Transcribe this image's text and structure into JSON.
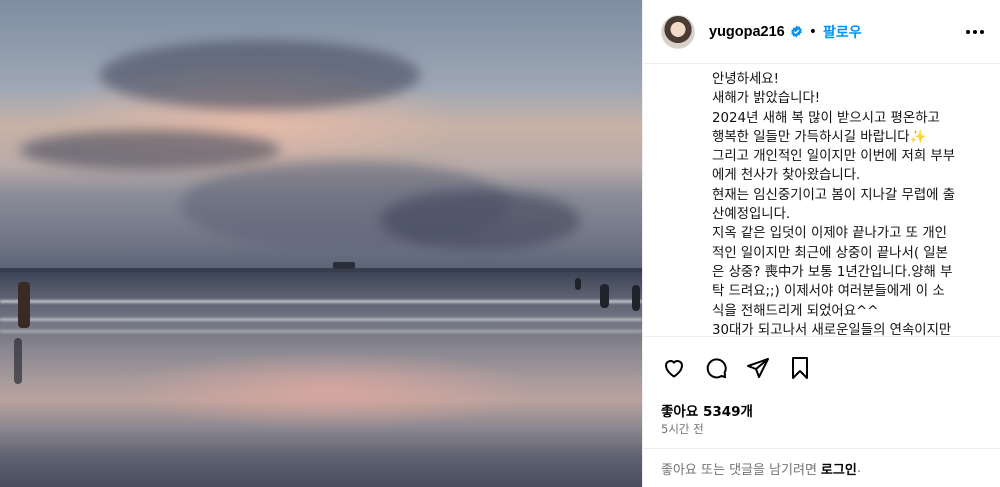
{
  "post": {
    "username": "yugopa216",
    "follow_label": "팔로우",
    "separator": "•",
    "caption_lines": [
      "안녕하세요!",
      "새해가 밝았습니다!",
      "2024년 새해 복 많이 받으시고 평온하고",
      "행복한 일들만 가득하시길 바랍니다✨",
      "그리고 개인적인 일이지만 이번에 저희 부부",
      "에게 천사가 찾아왔습니다.",
      "현재는 임신중기이고 봄이 지나갈 무렵에 출",
      "산예정입니다.",
      "지옥 같은 입덧이 이제야 끝나가고 또 개인",
      "적인 일이지만 최근에 상중이 끝나서( 일본",
      "은 상중? 喪中가 보통 1년간입니다.양해 부",
      "탁 드려요;;) 이제서야 여러분들에게 이 소",
      "식을 전해드리게 되었어요^^",
      "30대가 되고나서 새로운일들의 연속이지만"
    ],
    "likes_text": "좋아요 5349개",
    "time_text": "5시간 전",
    "login_prompt": "좋아요 또는 댓글을 남기려면",
    "login_link": "로그인",
    "login_suffix": "."
  },
  "icons": {
    "like": "heart-icon",
    "comment": "comment-icon",
    "share": "share-icon",
    "save": "bookmark-icon",
    "more": "more-icon",
    "verified": "verified-badge-icon"
  },
  "colors": {
    "follow": "#0095f6",
    "verified": "#0095f6",
    "muted": "#737373",
    "divider": "#efefef"
  }
}
